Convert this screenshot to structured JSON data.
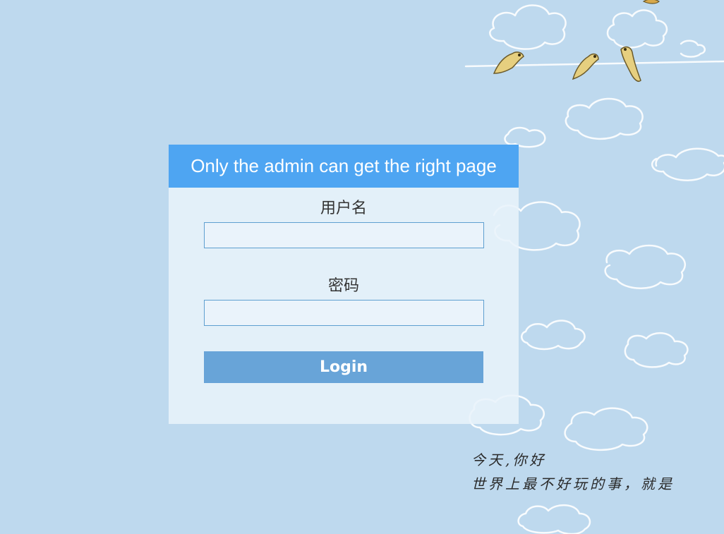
{
  "login": {
    "title": "Only the admin can get the right page",
    "username_label": "用户名",
    "password_label": "密码",
    "username_value": "",
    "password_value": "",
    "login_button": "Login"
  },
  "decoration": {
    "line1": "今天,你好",
    "line2": "世界上最不好玩的事，就是"
  },
  "colors": {
    "background": "#bed9ee",
    "header": "#4ea5f2",
    "button": "#68a4d8",
    "panel": "#e8f2fb"
  }
}
